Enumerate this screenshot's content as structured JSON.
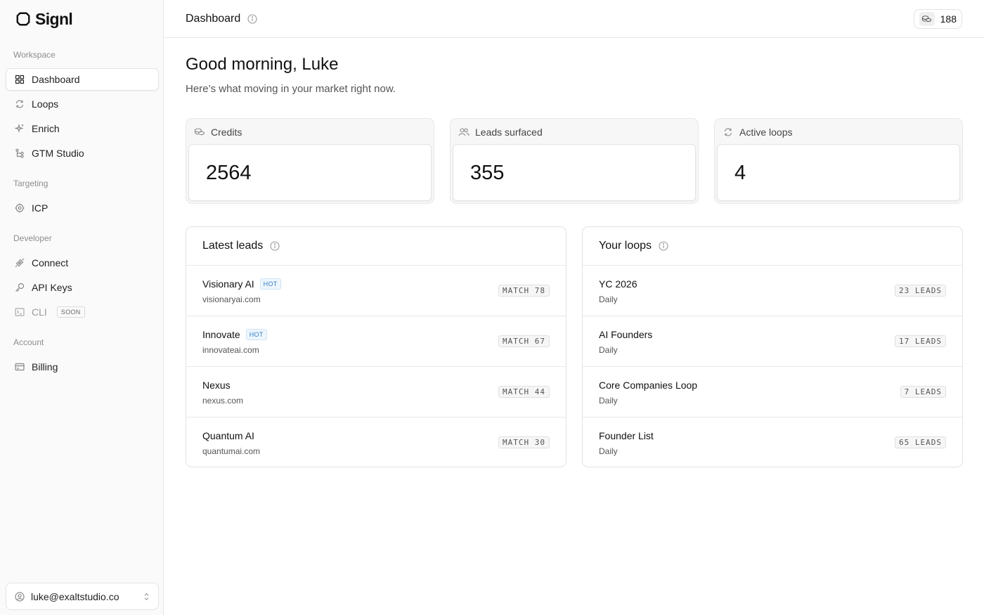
{
  "app": {
    "name": "Signl"
  },
  "sidebar": {
    "sections": [
      {
        "label": "Workspace"
      },
      {
        "label": "Targeting"
      },
      {
        "label": "Developer"
      },
      {
        "label": "Account"
      }
    ],
    "items": [
      {
        "label": "Dashboard",
        "icon": "grid-icon",
        "active": true
      },
      {
        "label": "Loops",
        "icon": "refresh-icon"
      },
      {
        "label": "Enrich",
        "icon": "sparkle-icon"
      },
      {
        "label": "GTM Studio",
        "icon": "flow-icon"
      },
      {
        "label": "ICP",
        "icon": "target-icon"
      },
      {
        "label": "Connect",
        "icon": "plug-icon"
      },
      {
        "label": "API Keys",
        "icon": "key-icon"
      },
      {
        "label": "CLI",
        "icon": "terminal-icon",
        "badge": "SOON",
        "disabled": true
      },
      {
        "label": "Billing",
        "icon": "card-icon"
      }
    ],
    "account_email": "luke@exaltstudio.co"
  },
  "header": {
    "title": "Dashboard",
    "credits": "188"
  },
  "main": {
    "greeting": "Good morning, Luke",
    "subtitle": "Here’s what moving in your market right now.",
    "stats": [
      {
        "label": "Credits",
        "value": "2564",
        "icon": "coins-icon"
      },
      {
        "label": "Leads surfaced",
        "value": "355",
        "icon": "users-icon"
      },
      {
        "label": "Active loops",
        "value": "4",
        "icon": "refresh-icon"
      }
    ],
    "latest_leads": {
      "title": "Latest leads",
      "rows": [
        {
          "name": "Visionary AI",
          "domain": "visionaryai.com",
          "hot": "HOT",
          "match": "MATCH 78"
        },
        {
          "name": "Innovate",
          "domain": "innovateai.com",
          "hot": "HOT",
          "match": "MATCH 67"
        },
        {
          "name": "Nexus",
          "domain": "nexus.com",
          "match": "MATCH 44"
        },
        {
          "name": "Quantum AI",
          "domain": "quantumai.com",
          "match": "MATCH 30"
        }
      ]
    },
    "loops": {
      "title": "Your loops",
      "rows": [
        {
          "name": "YC 2026",
          "frequency": "Daily",
          "leads": "23 LEADS"
        },
        {
          "name": "AI Founders",
          "frequency": "Daily",
          "leads": "17 LEADS"
        },
        {
          "name": "Core Companies Loop",
          "frequency": "Daily",
          "leads": "7 LEADS"
        },
        {
          "name": "Founder List",
          "frequency": "Daily",
          "leads": "65 LEADS"
        }
      ]
    }
  }
}
